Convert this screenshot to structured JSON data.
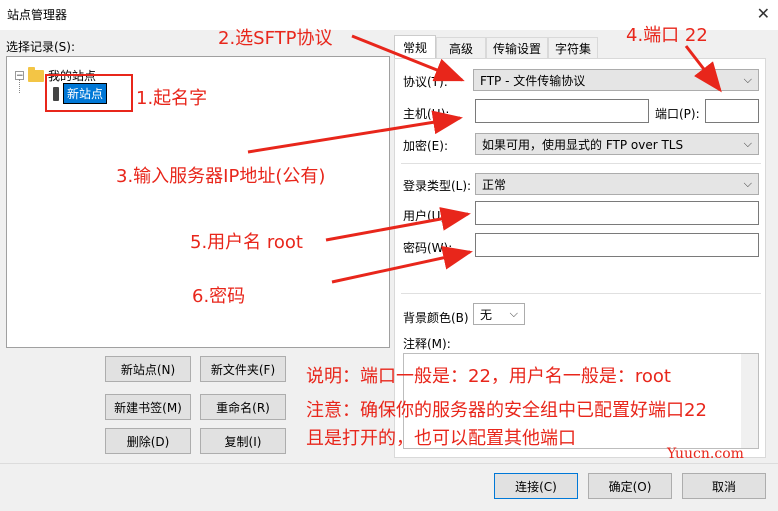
{
  "window": {
    "title": "站点管理器",
    "close_glyph": "✕"
  },
  "tree": {
    "label": "选择记录(S):",
    "root_label": "我的站点",
    "expand_glyph": "−",
    "new_site_label": "新站点"
  },
  "left_buttons": {
    "new_site": "新站点(N)",
    "new_folder": "新文件夹(F)",
    "new_bookmark": "新建书签(M)",
    "rename": "重命名(R)",
    "delete": "删除(D)",
    "copy": "复制(I)"
  },
  "tabs": [
    "常规",
    "高级",
    "传输设置",
    "字符集"
  ],
  "form": {
    "protocol_label": "协议(T):",
    "protocol_value": "FTP - 文件传输协议",
    "host_label": "主机(H):",
    "host_value": "",
    "port_label": "端口(P):",
    "port_value": "",
    "encryption_label": "加密(E):",
    "encryption_value": "如果可用，使用显式的 FTP over TLS",
    "login_type_label": "登录类型(L):",
    "login_type_value": "正常",
    "user_label": "用户(U):",
    "user_value": "",
    "password_label": "密码(W):",
    "password_value": "",
    "bg_color_label": "背景颜色(B)",
    "bg_color_value": "无",
    "notes_label": "注释(M):",
    "chevron_glyph": "⌵"
  },
  "bottom_buttons": {
    "connect": "连接(C)",
    "ok": "确定(O)",
    "cancel": "取消"
  },
  "annotations": {
    "a1": "1.起名字",
    "a2": "2.选SFTP协议",
    "a3": "3.输入服务器IP地址(公有)",
    "a4": "4.端口 22",
    "a5": "5.用户名 root",
    "a6": "6.密码",
    "note1": "说明：端口一般是：22，用户名一般是：root",
    "note2": "注意：确保你的服务器的安全组中已配置好端口22",
    "note3": "且是打开的，也可以配置其他端口",
    "color": "#e8261b"
  },
  "watermark": "Yuucn.com"
}
